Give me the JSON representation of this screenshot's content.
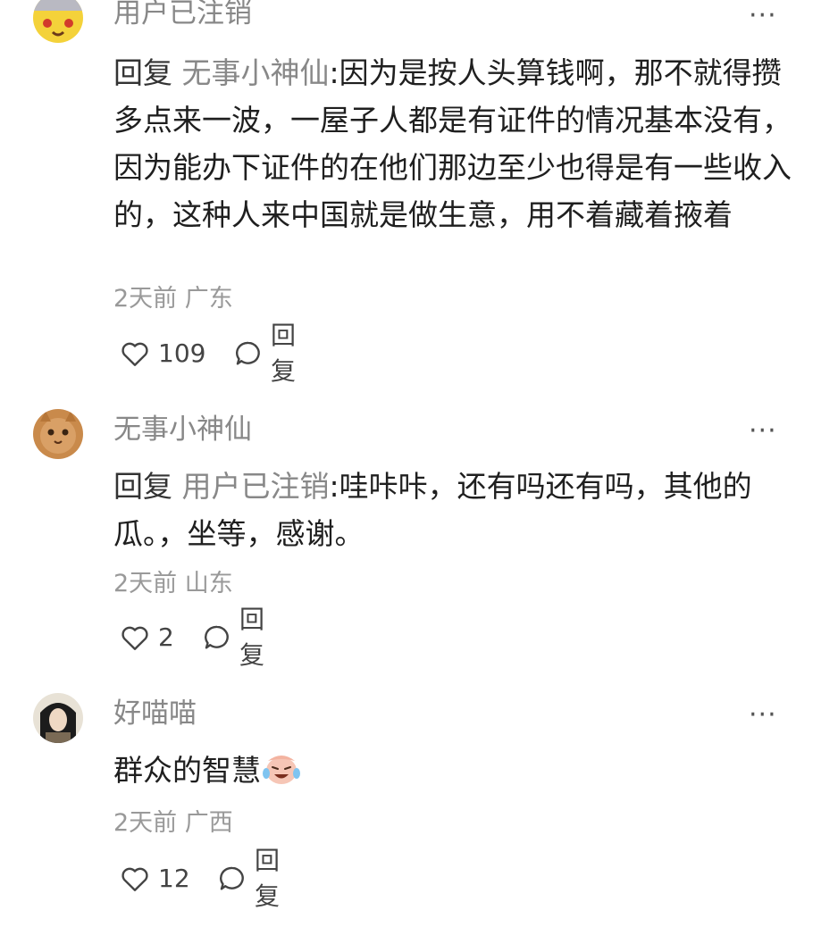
{
  "comments": [
    {
      "username": "用户已注销",
      "more": "···",
      "reply_word": "回复",
      "reply_to": "无事小神仙",
      "sep": ":",
      "text": "因为是按人头算钱啊，那不就得攒多点来一波，一屋子人都是有证件的情况基本没有，因为能办下证件的在他们那边至少也得是有一些收入的，这种人来中国就是做生意，用不着藏着掖着",
      "time": "2天前",
      "location": "广东",
      "likes": "109",
      "reply_label": "回复"
    },
    {
      "username": "无事小神仙",
      "more": "···",
      "reply_word": "回复",
      "reply_to": "用户已注销",
      "sep": ":",
      "text": "哇咔咔，还有吗还有吗，其他的瓜。，坐等，感谢。",
      "time": "2天前",
      "location": "山东",
      "likes": "2",
      "reply_label": "回复"
    },
    {
      "username": "好喵喵",
      "more": "···",
      "text": "群众的智慧",
      "emoji": "crying-laughing-emoji",
      "time": "2天前",
      "location": "广西",
      "likes": "12",
      "reply_label": "回复"
    }
  ],
  "colors": {
    "username": "#888888",
    "text": "#1f1f1f",
    "meta": "#999999",
    "icon": "#444444"
  },
  "icons": {
    "like": "heart-outline-icon",
    "reply": "speech-bubble-icon",
    "more": "more-dots-icon"
  }
}
